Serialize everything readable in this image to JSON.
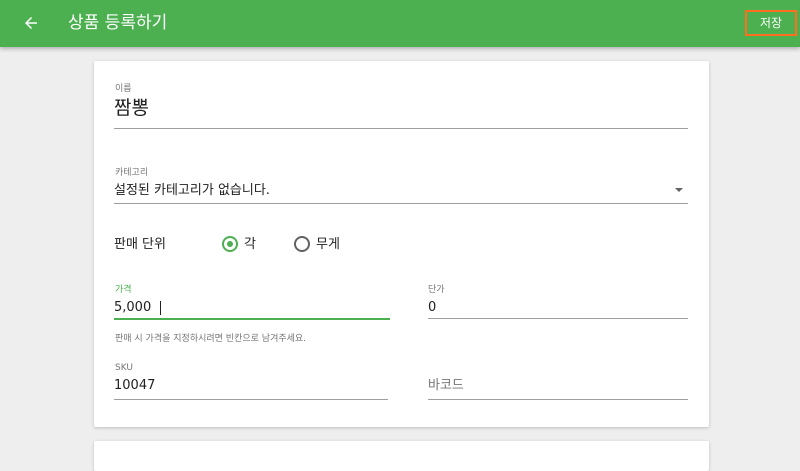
{
  "colors": {
    "primary": "#4caf50",
    "highlight": "#ff6d1f"
  },
  "appbar": {
    "title": "상품 등록하기",
    "save_label": "저장",
    "back_icon": "arrow-left-icon"
  },
  "form": {
    "name": {
      "label": "이름",
      "value": "짬뽕"
    },
    "category": {
      "label": "카테고리",
      "value": "설정된 카테고리가 없습니다."
    },
    "sale_unit": {
      "label": "판매 단위",
      "options": [
        {
          "label": "각",
          "selected": true
        },
        {
          "label": "무게",
          "selected": false
        }
      ]
    },
    "price": {
      "label": "가격",
      "value": "5,000",
      "helper": "판매 시 가격을 지정하시려면 빈칸으로 남겨주세요."
    },
    "unit_price": {
      "label": "단가",
      "value": "0"
    },
    "sku": {
      "label": "SKU",
      "value": "10047"
    },
    "barcode": {
      "placeholder": "바코드",
      "value": ""
    }
  }
}
